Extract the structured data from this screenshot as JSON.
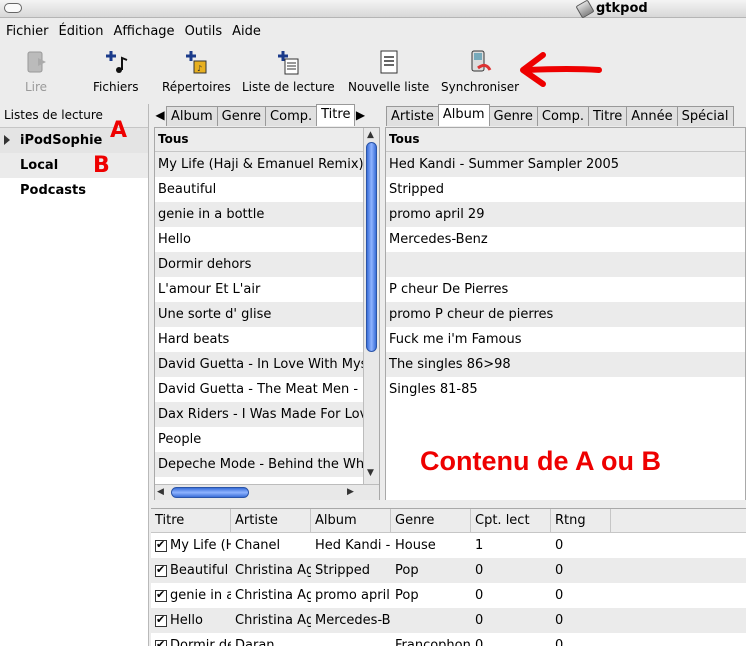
{
  "window": {
    "title": "gtkpod"
  },
  "menu": [
    "Fichier",
    "Édition",
    "Affichage",
    "Outils",
    "Aide"
  ],
  "toolbar": {
    "play": "Lire",
    "files": "Fichiers",
    "dirs": "Répertoires",
    "playlist": "Liste de lecture",
    "new_list": "Nouvelle liste",
    "sync": "Synchroniser"
  },
  "playlists": {
    "header": "Listes de lecture",
    "items": [
      "iPodSophie",
      "Local",
      "Podcasts"
    ]
  },
  "annotations": {
    "a": "A",
    "b": "B",
    "content": "Contenu de A ou B"
  },
  "left_sort": {
    "tabs": [
      "Album",
      "Genre",
      "Comp.",
      "Titre"
    ],
    "active_tab": "Titre",
    "header": "Tous",
    "rows": [
      "My Life (Haji & Emanuel Remix)",
      "Beautiful",
      "genie in a bottle",
      "Hello",
      "Dormir dehors",
      "L'amour Et L'air",
      "Une sorte d' glise",
      "Hard beats",
      "David Guetta - In Love With Mys",
      "David Guetta - The Meat Men -",
      "Dax Riders - I Was Made For Lov",
      "People",
      "Depeche Mode - Behind the Wh"
    ]
  },
  "right_sort": {
    "tabs": [
      "Artiste",
      "Album",
      "Genre",
      "Comp.",
      "Titre",
      "Année",
      "Spécial"
    ],
    "active_tab": "Album",
    "header": "Tous",
    "rows": [
      "Hed Kandi - Summer Sampler 2005",
      "Stripped",
      "promo april 29",
      "Mercedes-Benz",
      "",
      "P cheur De Pierres",
      "promo P cheur de pierres",
      "Fuck me i'm Famous",
      "The singles 86>98",
      "Singles 81-85"
    ]
  },
  "tracks": {
    "columns": [
      "Titre",
      "Artiste",
      "Album",
      "Genre",
      "Cpt. lect",
      "Rtng"
    ],
    "rows": [
      [
        "My Life (H",
        "Chanel",
        "Hed Kandi -",
        "House",
        "1",
        "0"
      ],
      [
        "Beautiful",
        "Christina Ag",
        "Stripped",
        "Pop",
        "0",
        "0"
      ],
      [
        "genie in a",
        "Christina Ag",
        "promo april",
        "Pop",
        "0",
        "0"
      ],
      [
        "Hello",
        "Christina Ag",
        "Mercedes-B",
        "",
        "0",
        "0"
      ],
      [
        "Dormir de",
        "Daran",
        "",
        "Francophon",
        "0",
        "0"
      ]
    ]
  },
  "colors": {
    "annotation": "#e00000",
    "scroll_thumb": "#3a6ed8"
  }
}
